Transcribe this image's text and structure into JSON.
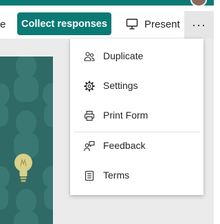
{
  "toolbar": {
    "edge_fragment": "e",
    "collect_label": "Collect responses",
    "present_label": "Present",
    "more_label": "···"
  },
  "more_menu": {
    "items": [
      {
        "label": "Duplicate",
        "icon": "people-duplicate-icon"
      },
      {
        "label": "Settings",
        "icon": "gear-icon"
      },
      {
        "label": "Print Form",
        "icon": "printer-icon"
      },
      {
        "label": "Feedback",
        "icon": "feedback-person-icon"
      },
      {
        "label": "Terms",
        "icon": "document-icon"
      }
    ]
  },
  "colors": {
    "brand": "#0b7a75",
    "hero": "#2f6a66",
    "bulb": "#d9d08a"
  }
}
